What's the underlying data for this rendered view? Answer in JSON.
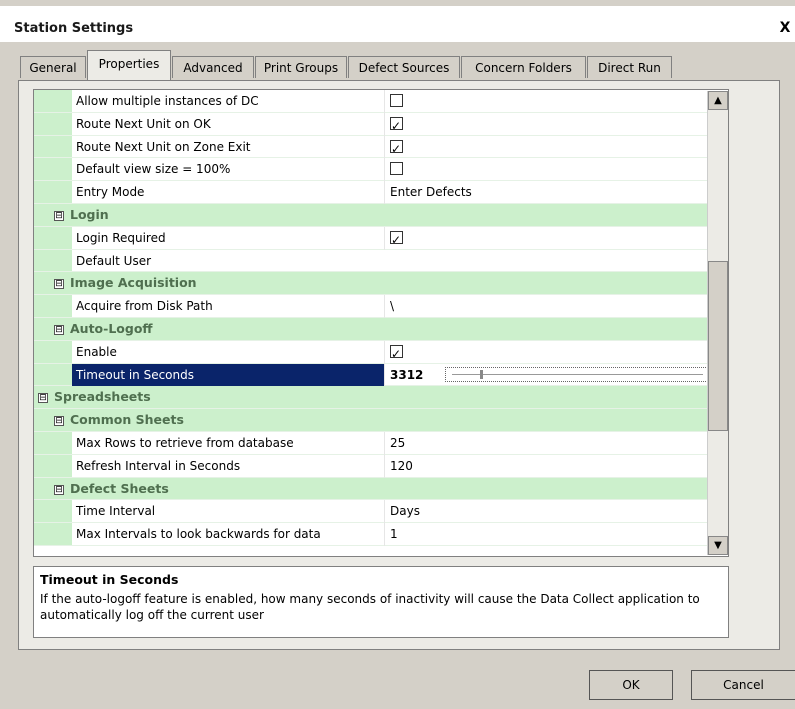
{
  "window": {
    "title": "Station Settings",
    "close_label": "X"
  },
  "tabs": [
    {
      "label": "General"
    },
    {
      "label": "Properties"
    },
    {
      "label": "Advanced"
    },
    {
      "label": "Print Groups"
    },
    {
      "label": "Defect Sources"
    },
    {
      "label": "Concern Folders"
    },
    {
      "label": "Direct Run"
    }
  ],
  "rows": [
    {
      "type": "prop",
      "label": "Allow multiple instances of DC",
      "value_type": "checkbox",
      "checked": false
    },
    {
      "type": "prop",
      "label": "Route Next Unit on OK",
      "value_type": "checkbox",
      "checked": true
    },
    {
      "type": "prop",
      "label": "Route Next Unit on Zone Exit",
      "value_type": "checkbox",
      "checked": true
    },
    {
      "type": "prop",
      "label": "Default view size = 100%",
      "value_type": "checkbox",
      "checked": false
    },
    {
      "type": "prop",
      "label": "Entry Mode",
      "value_type": "text",
      "value": "Enter Defects"
    },
    {
      "type": "category",
      "level": 2,
      "label": "Login",
      "toggle": "⊟"
    },
    {
      "type": "prop",
      "label": "Login Required",
      "value_type": "checkbox",
      "checked": true
    },
    {
      "type": "prop",
      "label": "Default User",
      "value_type": "text",
      "value": ""
    },
    {
      "type": "category",
      "level": 2,
      "label": "Image Acquisition",
      "toggle": "⊟"
    },
    {
      "type": "prop",
      "label": "Acquire from Disk Path",
      "value_type": "text",
      "value": "\\"
    },
    {
      "type": "category",
      "level": 2,
      "label": "Auto-Logoff",
      "toggle": "⊟"
    },
    {
      "type": "prop",
      "label": "Enable",
      "value_type": "checkbox",
      "checked": true
    },
    {
      "type": "prop",
      "label": "Timeout in Seconds",
      "value_type": "slider",
      "value": "3312",
      "selected": true
    },
    {
      "type": "category",
      "level": 1,
      "label": "Spreadsheets",
      "toggle": "⊟"
    },
    {
      "type": "category",
      "level": 2,
      "label": "Common Sheets",
      "toggle": "⊟"
    },
    {
      "type": "prop",
      "label": "Max Rows to retrieve from database",
      "value_type": "text",
      "value": "25"
    },
    {
      "type": "prop",
      "label": "Refresh Interval in Seconds",
      "value_type": "text",
      "value": "120"
    },
    {
      "type": "category",
      "level": 2,
      "label": "Defect Sheets",
      "toggle": "⊟"
    },
    {
      "type": "prop",
      "label": "Time Interval",
      "value_type": "text",
      "value": "Days"
    },
    {
      "type": "prop",
      "label": "Max Intervals to look backwards for data",
      "value_type": "text",
      "value": "1"
    }
  ],
  "scrollbar": {
    "up_glyph": "▲",
    "down_glyph": "▼"
  },
  "help": {
    "title": "Timeout in Seconds",
    "text": "If the auto-logoff feature is enabled, how many seconds of inactivity will cause the Data Collect application to automatically log off the current user"
  },
  "buttons": {
    "ok": "OK",
    "cancel": "Cancel"
  },
  "colors": {
    "category_bg": "#ccf0cc",
    "selection_bg": "#0a246a",
    "dialog_bg": "#d4d0c8"
  }
}
